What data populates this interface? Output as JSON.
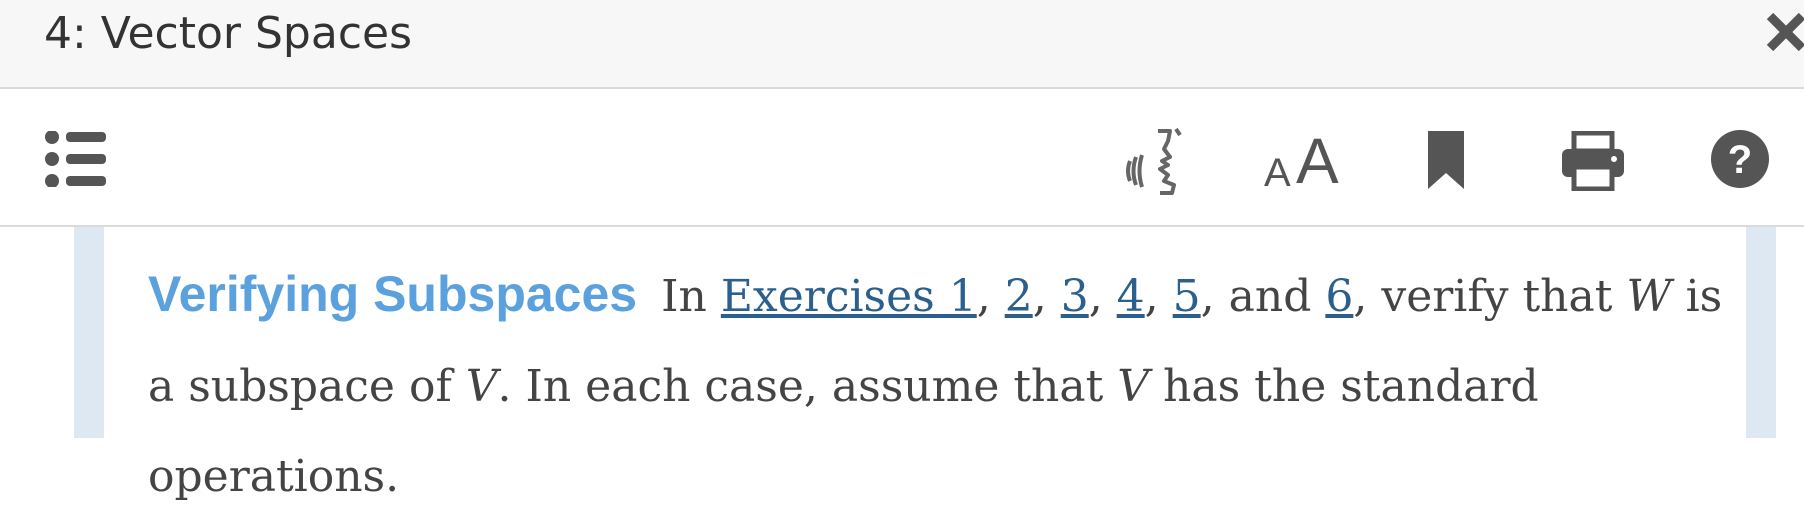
{
  "window": {
    "title": "4: Vector Spaces"
  },
  "toolbar": {
    "buttons": [
      {
        "name": "table-of-contents",
        "icon": "list-icon"
      },
      {
        "name": "read-aloud",
        "icon": "speaker-icon"
      },
      {
        "name": "text-size",
        "icon": "text-size-icon",
        "label_small": "A",
        "label_large": "A"
      },
      {
        "name": "bookmark",
        "icon": "bookmark-icon"
      },
      {
        "name": "print",
        "icon": "printer-icon"
      },
      {
        "name": "help",
        "icon": "help-icon",
        "label": "?"
      }
    ]
  },
  "content": {
    "heading": "Verifying Subspaces",
    "intro": "In",
    "links": [
      "Exercises 1",
      "2",
      "3",
      "4",
      "5",
      "6"
    ],
    "sep1": ", ",
    "sep_and": ", and ",
    "after_links": ", verify that ",
    "var_w": "W",
    "text_is": " is a subspace of ",
    "var_v1": "V",
    "text_case": ". In each case, assume that ",
    "var_v2": "V",
    "text_end": " has the standard operations."
  },
  "colors": {
    "heading": "#5ba1de",
    "link": "#2b5f8e",
    "side_band": "#dde8f2",
    "icon": "#555555"
  }
}
